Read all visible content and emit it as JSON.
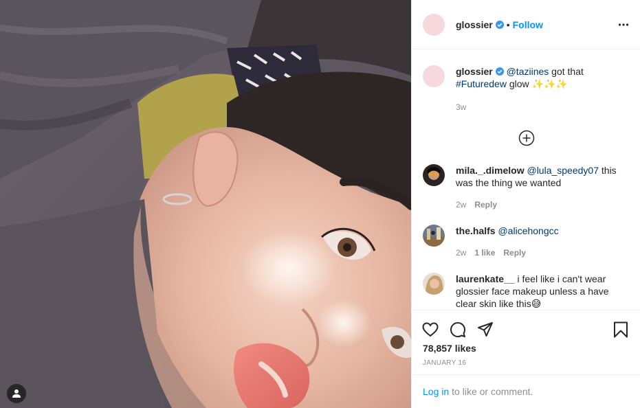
{
  "header": {
    "username": "glossier",
    "separator": "•",
    "follow_label": "Follow"
  },
  "caption": {
    "username": "glossier",
    "mention": "@taziines",
    "text_after_mention": " got that ",
    "hashtag": "#Futuredew",
    "text_end": " glow ✨✨✨",
    "age": "3w"
  },
  "comments": [
    {
      "username": "mila._.dimelow",
      "mention": "@lula_speedy07",
      "text": " this was the thing we wanted",
      "age": "2w",
      "likes": "",
      "reply_label": "Reply"
    },
    {
      "username": "the.halfs",
      "mention": "@alicehongcc",
      "text": "",
      "age": "2w",
      "likes": "1 like",
      "reply_label": "Reply"
    },
    {
      "username": "laurenkate__",
      "mention": "",
      "text": " i feel like i can't wear glossier face makeup unless a have clear skin like this😅",
      "age": "",
      "likes": "",
      "reply_label": ""
    }
  ],
  "likes_count": "78,857 likes",
  "date": "January 16",
  "login_bar": {
    "login_label": "Log in",
    "text": "to like or comment."
  },
  "colors": {
    "link_blue": "#0095f6",
    "mention_blue": "#00376b",
    "verified_blue": "#3897f0",
    "muted_grey": "#8e8e8e",
    "avatar_pink": "#f7d9dd"
  },
  "icons": [
    "verified-badge-icon",
    "more-options-icon",
    "load-more-comments-icon",
    "heart-icon",
    "comment-icon",
    "share-icon",
    "bookmark-icon",
    "user-tag-icon"
  ]
}
